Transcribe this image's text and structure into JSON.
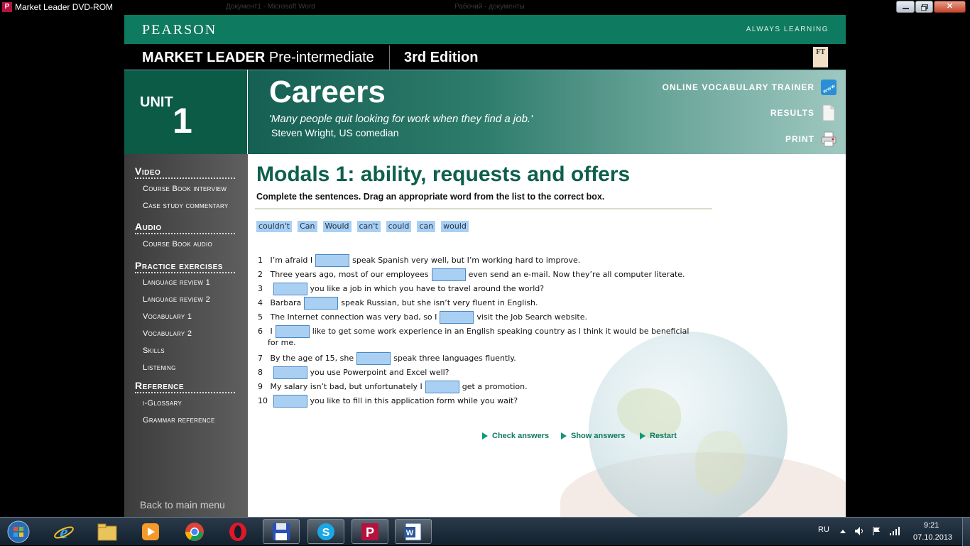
{
  "window": {
    "app_icon_letter": "P",
    "title": "Market Leader DVD-ROM",
    "ghost_title_1": "Документ1 - Microsoft Word",
    "ghost_title_2": "Рабочий - документы",
    "close_glyph": "✕"
  },
  "header": {
    "brand": "PEARSON",
    "tagline": "ALWAYS LEARNING",
    "course_bold": "MARKET LEADER",
    "course_level": "Pre-intermediate",
    "edition": "3rd Edition",
    "ft_logo": "FT"
  },
  "unit": {
    "label": "UNIT",
    "number": "1",
    "title": "Careers",
    "quote": "'Many people quit looking for work when they find a job.'",
    "author": "Steven Wright, US comedian"
  },
  "tools": [
    {
      "label": "ONLINE VOCABULARY TRAINER",
      "icon": "www-globe-icon"
    },
    {
      "label": "RESULTS",
      "icon": "document-icon"
    },
    {
      "label": "PRINT",
      "icon": "printer-icon"
    }
  ],
  "sidebar": {
    "groups": [
      {
        "label": "Video",
        "items": [
          "Course Book interview",
          "Case study commentary"
        ]
      },
      {
        "label": "Audio",
        "items": [
          "Course Book audio"
        ]
      },
      {
        "label": "Practice exercises",
        "items": [
          "Language review 1",
          "Language review 2",
          "Vocabulary 1",
          "Vocabulary 2",
          "Skills",
          "Listening"
        ]
      },
      {
        "label": "Reference",
        "items": [
          "i-Glossary",
          "Grammar reference"
        ]
      }
    ],
    "back": "Back to main menu"
  },
  "exercise": {
    "title": "Modals 1: ability, requests and offers",
    "instruction": "Complete the sentences. Drag an appropriate word from the list to the correct box.",
    "words": [
      "couldn't",
      "Can",
      "Would",
      "can't",
      "could",
      "can",
      "would"
    ],
    "questions": [
      {
        "num": "1",
        "before": "I’m afraid I",
        "after": "speak Spanish very well, but I’m working hard to improve.",
        "after2": ""
      },
      {
        "num": "2",
        "before": "Three years ago, most of our employees",
        "after": "even send an e-mail. Now they’re all computer literate.",
        "after2": ""
      },
      {
        "num": "3",
        "before": "",
        "after": "you like a job in which you have to travel around the world?",
        "after2": ""
      },
      {
        "num": "4",
        "before": "Barbara",
        "after": "speak Russian, but she isn’t very fluent in English.",
        "after2": ""
      },
      {
        "num": "5",
        "before": "The Internet connection was very bad, so I",
        "after": "visit the Job Search website.",
        "after2": ""
      },
      {
        "num": "6",
        "before": "I",
        "after": "like to get some work experience in an English speaking country as I think it would be beneficial",
        "after2": "for me."
      },
      {
        "num": "7",
        "before": "By the age of 15, she",
        "after": "speak three languages fluently.",
        "after2": ""
      },
      {
        "num": "8",
        "before": "",
        "after": "you use Powerpoint and Excel well?",
        "after2": ""
      },
      {
        "num": "9",
        "before": "My salary isn’t bad, but unfortunately I",
        "after": "get a promotion.",
        "after2": ""
      },
      {
        "num": "10",
        "before": "",
        "after": "you like to fill in this application form while you wait?",
        "after2": ""
      }
    ],
    "controls": [
      "Check answers",
      "Show answers",
      "Restart"
    ]
  },
  "taskbar": {
    "apps": [
      "start-orb",
      "internet-explorer",
      "file-explorer",
      "media-player",
      "chrome",
      "opera",
      "save-disk",
      "skype",
      "pearson-app",
      "microsoft-word"
    ],
    "language": "RU",
    "time": "9:21",
    "date": "07.10.2013"
  },
  "colors": {
    "pearson_green": "#0e7a60",
    "unit_green": "#0b5b47",
    "title_green": "#0e5f4c",
    "drop_box_blue": "#a9d0f3"
  }
}
